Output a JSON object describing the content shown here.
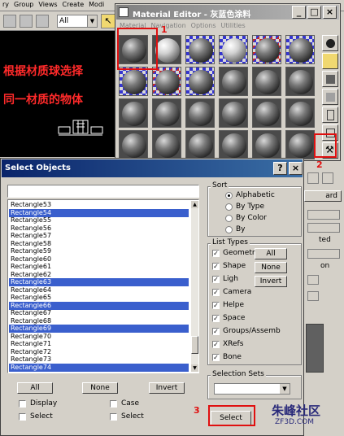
{
  "bg": {
    "menu": [
      "ry",
      "Group",
      "Views",
      "Create",
      "Modi"
    ],
    "toolbar_select": "All",
    "annotation_line1": "根据材质球选择",
    "annotation_line2": "同一材质的物体"
  },
  "material_editor": {
    "title": "Material Editor - 灰蓝色涂料",
    "menu": [
      "Material",
      "Navigation",
      "Options",
      "Utilities"
    ]
  },
  "dialog": {
    "title": "Select Objects",
    "filter_value": "",
    "objects": [
      {
        "name": "Rectangle53",
        "selected": false
      },
      {
        "name": "Rectangle54",
        "selected": true
      },
      {
        "name": "Rectangle55",
        "selected": false
      },
      {
        "name": "Rectangle56",
        "selected": false
      },
      {
        "name": "Rectangle57",
        "selected": false
      },
      {
        "name": "Rectangle58",
        "selected": false
      },
      {
        "name": "Rectangle59",
        "selected": false
      },
      {
        "name": "Rectangle60",
        "selected": false
      },
      {
        "name": "Rectangle61",
        "selected": false
      },
      {
        "name": "Rectangle62",
        "selected": false
      },
      {
        "name": "Rectangle63",
        "selected": true
      },
      {
        "name": "Rectangle64",
        "selected": false
      },
      {
        "name": "Rectangle65",
        "selected": false
      },
      {
        "name": "Rectangle66",
        "selected": true
      },
      {
        "name": "Rectangle67",
        "selected": false
      },
      {
        "name": "Rectangle68",
        "selected": false
      },
      {
        "name": "Rectangle69",
        "selected": true
      },
      {
        "name": "Rectangle70",
        "selected": false
      },
      {
        "name": "Rectangle71",
        "selected": false
      },
      {
        "name": "Rectangle72",
        "selected": false
      },
      {
        "name": "Rectangle73",
        "selected": false
      },
      {
        "name": "Rectangle74",
        "selected": true
      }
    ],
    "buttons": {
      "all": "All",
      "none": "None",
      "invert": "Invert",
      "select": "Select"
    },
    "checks": {
      "display": "Display",
      "case": "Case",
      "select_left": "Select",
      "select_right": "Select"
    },
    "sort": {
      "title": "Sort",
      "options": [
        "Alphabetic",
        "By Type",
        "By Color",
        "By"
      ],
      "selected": "Alphabetic"
    },
    "list_types": {
      "title": "List Types",
      "items": [
        "Geometr",
        "Shape",
        "Ligh",
        "Camera",
        "Helpe",
        "Space",
        "Groups/Assemb",
        "XRefs",
        "Bone"
      ],
      "all_label": "All",
      "none_label": "None",
      "invert_label": "Invert"
    },
    "selection_sets": {
      "title": "Selection Sets",
      "value": ""
    }
  },
  "right_panel": {
    "label_ard": "ard",
    "label_ted": "ted",
    "label_on": "on"
  },
  "steps": {
    "step1": "1",
    "step2": "2",
    "step3": "3"
  },
  "watermark": {
    "line1": "朱峰社区",
    "line2": "ZF3D.COM"
  },
  "accent_color": "#e01010"
}
